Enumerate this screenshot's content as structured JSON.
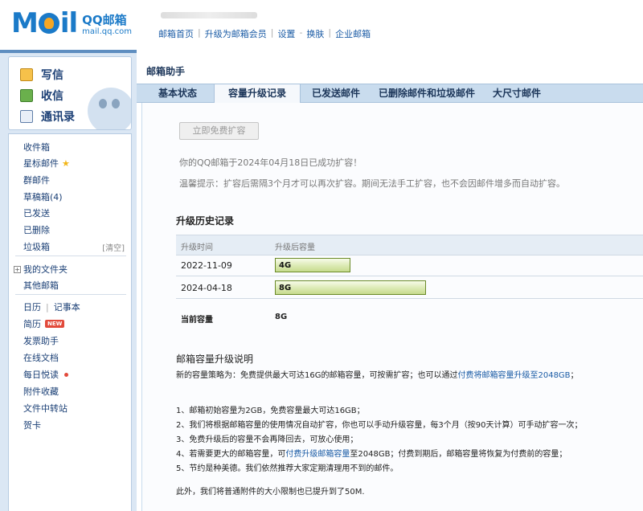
{
  "header": {
    "logo_text": "MOil",
    "logo_qq": "QQ邮箱",
    "logo_url": "mail.qq.com",
    "nav": [
      "邮箱首页",
      "升级为邮箱会员",
      "设置",
      "换肤",
      "企业邮箱"
    ],
    "nav_seps": [
      "|",
      "|",
      "-",
      "|"
    ]
  },
  "sidebar": {
    "compose": [
      {
        "label": "写信",
        "icon": "write-icon"
      },
      {
        "label": "收信",
        "icon": "inbox-icon"
      },
      {
        "label": "通讯录",
        "icon": "contacts-icon"
      }
    ],
    "folders": {
      "inbox": "收件箱",
      "starred": "星标邮件",
      "group": "群邮件",
      "drafts": "草稿箱(4)",
      "sent": "已发送",
      "deleted": "已删除",
      "spam": "垃圾箱",
      "spam_clear": "[清空]",
      "my_folders": "我的文件夹",
      "other_mailboxes": "其他邮箱",
      "calendar": "日历",
      "notepad": "记事本",
      "resume": "简历",
      "new_badge": "NEW",
      "invoice": "发票助手",
      "online_docs": "在线文档",
      "daily_reading": "每日悦读",
      "attachments": "附件收藏",
      "file_transfer": "文件中转站",
      "cards": "贺卡"
    },
    "colors": {
      "sidebar_bg": "#dbe7f4",
      "accent": "#1a5ba5"
    }
  },
  "main": {
    "title": "邮箱助手",
    "tabs": [
      "基本状态",
      "容量升级记录",
      "已发送邮件",
      "已删除邮件和垃圾邮件",
      "大尺寸邮件"
    ],
    "active_tab": "容量升级记录",
    "expand_button": "立即免费扩容",
    "msg_expanded": "你的QQ邮箱于2024年04月18日已成功扩容！",
    "msg_tip": "温馨提示：扩容后需隔3个月才可以再次扩容。期间无法手工扩容，也不会因邮件增多而自动扩容。",
    "history_title": "升级历史记录",
    "history_cols": [
      "升级时间",
      "升级后容量"
    ],
    "history": [
      {
        "date": "2022-11-09",
        "capacity": "4G",
        "capacity_gb": 4
      },
      {
        "date": "2024-04-18",
        "capacity": "8G",
        "capacity_gb": 8
      }
    ],
    "current_label": "当前容量",
    "current_value": "8G",
    "desc_title": "邮箱容量升级说明",
    "desc_line_prefix": "新的容量策略为：免费提供最大可达16G的邮箱容量，可按需扩容；也可以通过",
    "desc_line_link": "付费将邮箱容量升级至2048GB",
    "desc_line_suffix": "；",
    "rules": [
      {
        "text": "1、邮箱初始容量为2GB，免费容量最大可达16GB；"
      },
      {
        "text": "2、我们将根据邮箱容量的使用情况自动扩容，你也可以手动升级容量，每3个月（按90天计算）可手动扩容一次；"
      },
      {
        "text": "3、免费升级后的容量不会再降回去，可放心使用；"
      },
      {
        "prefix": "4、若需要更大的邮箱容量，可",
        "link": "付费升级邮箱容量",
        "suffix": "至2048GB；付费到期后，邮箱容量将恢复为付费前的容量；"
      },
      {
        "text": "5、节约是种美德。我们依然推荐大家定期清理用不到的邮件。"
      }
    ],
    "footnote": "此外，我们将普通附件的大小限制也已提升到了50M."
  }
}
